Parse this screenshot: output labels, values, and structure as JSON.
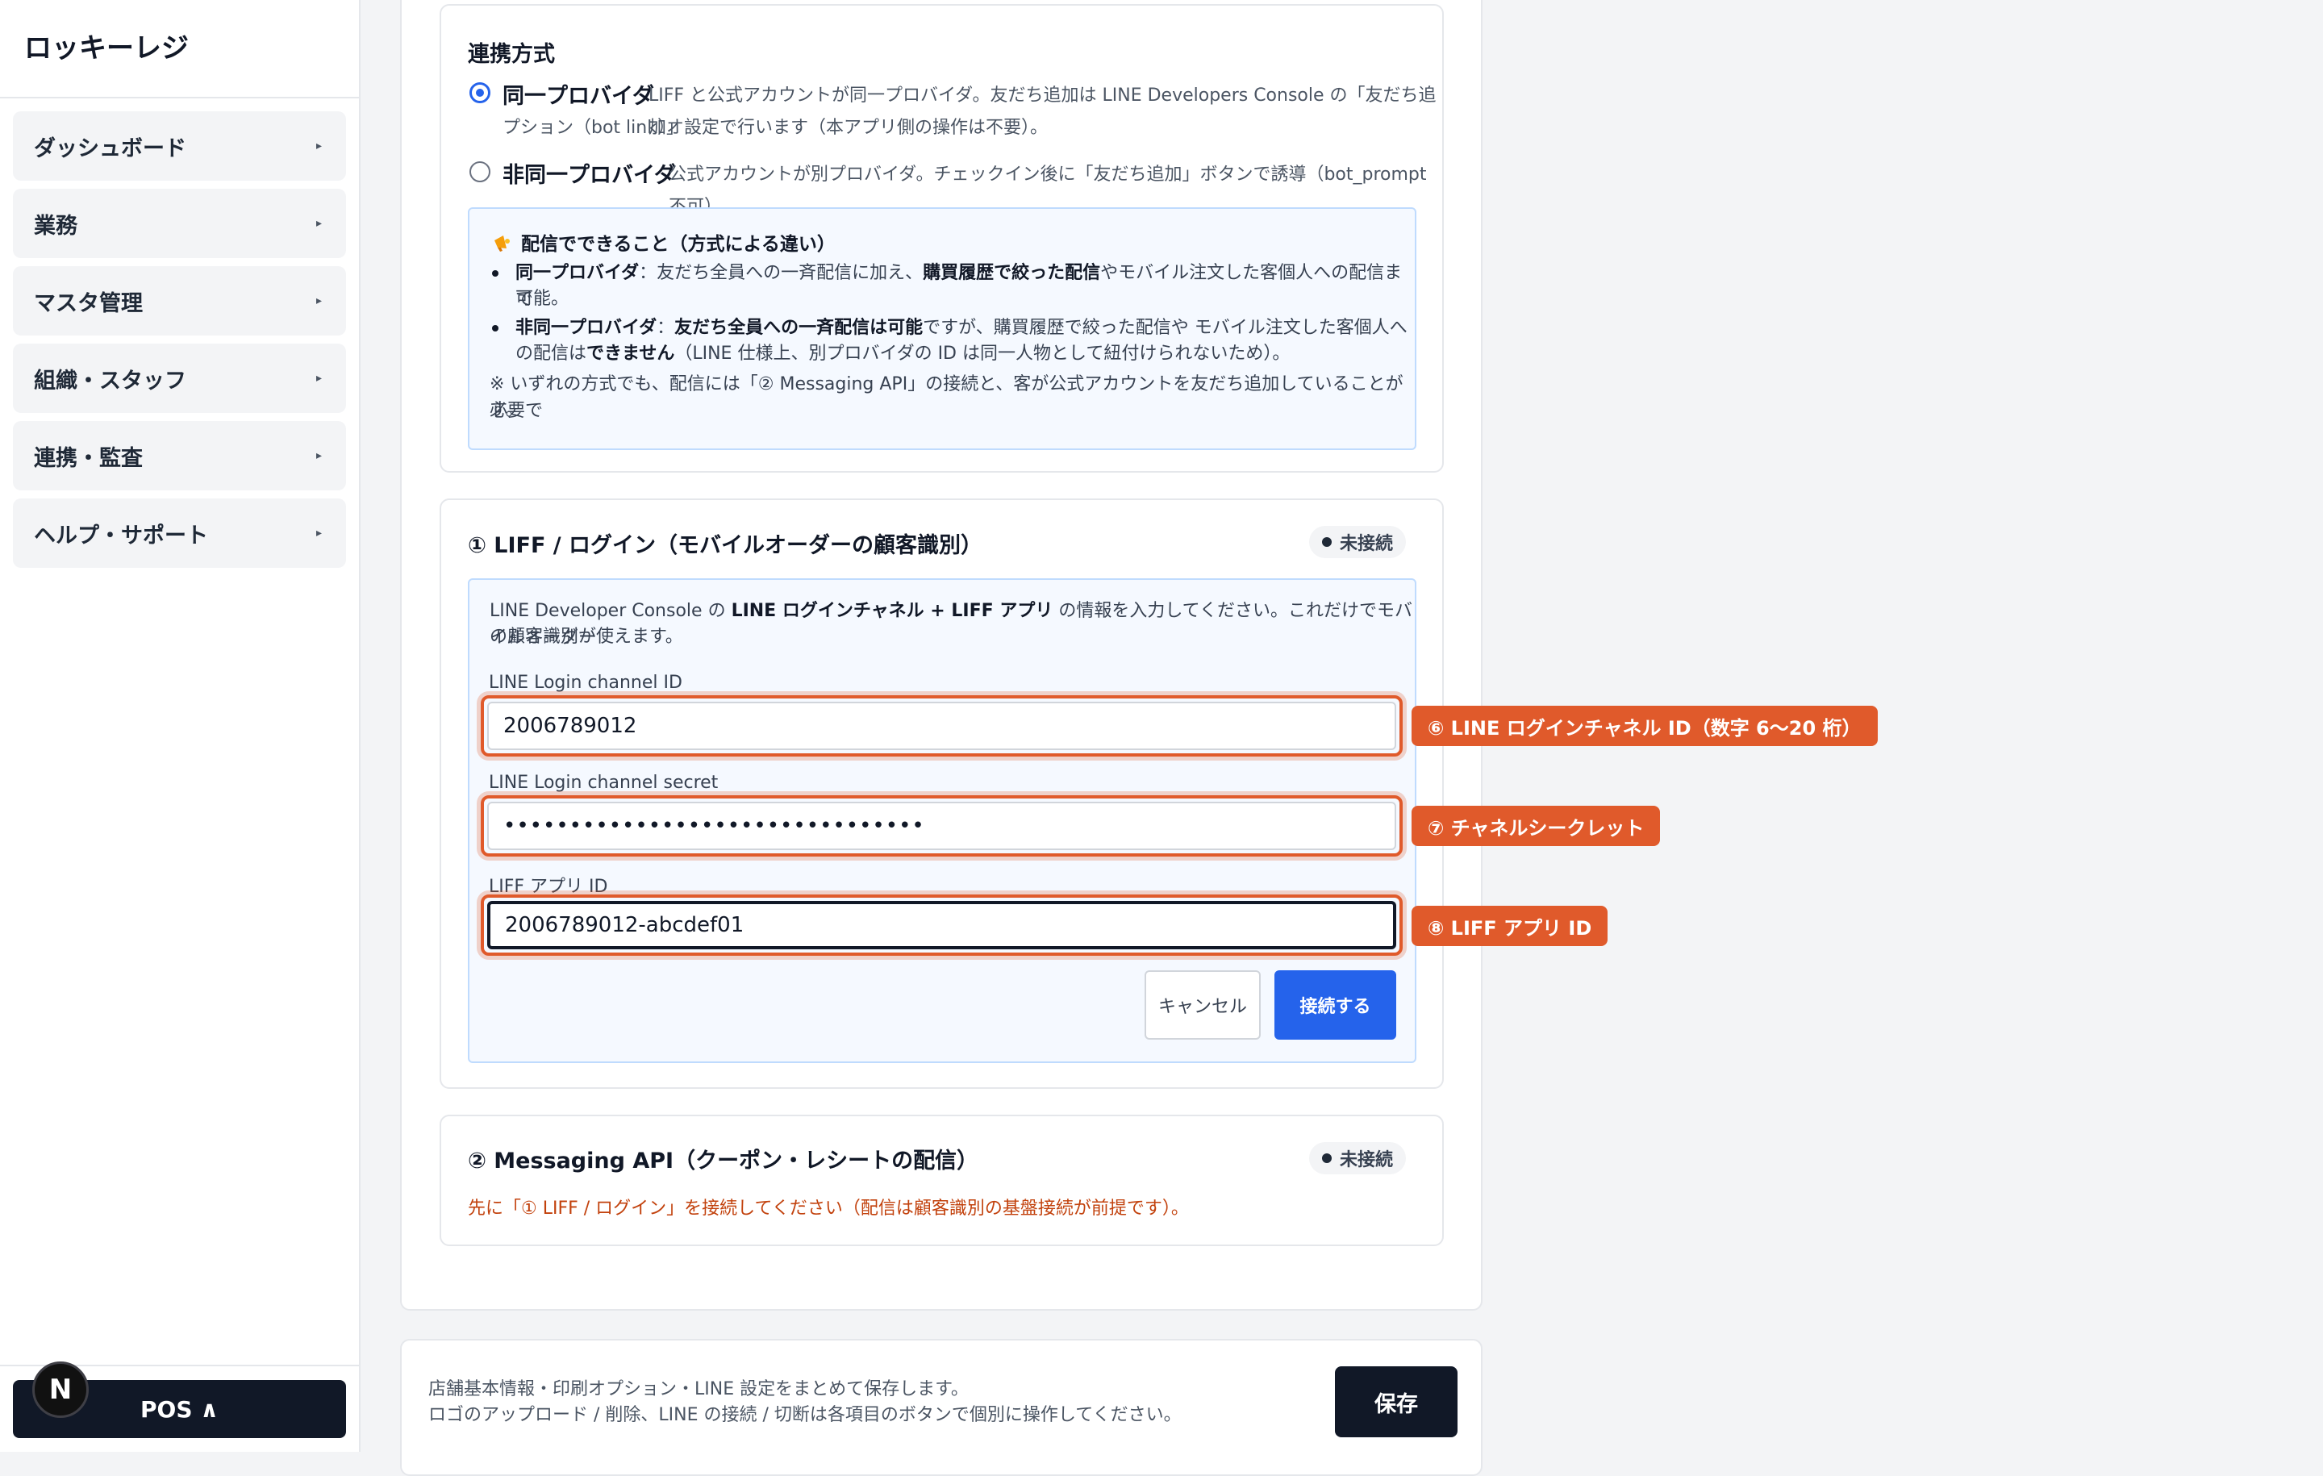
{
  "sidebar": {
    "brand": "ロッキーレジ",
    "items": [
      {
        "label": "ダッシュボード"
      },
      {
        "label": "業務"
      },
      {
        "label": "マスタ管理"
      },
      {
        "label": "組織・スタッフ"
      },
      {
        "label": "連携・監査"
      },
      {
        "label": "ヘルプ・サポート"
      }
    ],
    "arrow": "▸",
    "pos_button": "POS ∧",
    "n_badge": "N"
  },
  "connection": {
    "title": "連携方式",
    "options": [
      {
        "label": "同一プロバイダ",
        "desc_line1": "LIFF と公式アカウントが同一プロバイダ。友だち追加は LINE Developers Console の「友だち追加オ",
        "desc_line2": "プション（bot link）」設定で行います（本アプリ側の操作は不要）。",
        "checked": true
      },
      {
        "label": "非同一プロバイダ",
        "desc_line1": "公式アカウントが別プロバイダ。チェックイン後に「友だち追加」ボタンで誘導（bot_prompt 不可）",
        "checked": false
      }
    ],
    "info": {
      "icon": "megaphone-icon",
      "title": "配信でできること（方式による違い）",
      "b1_l1_a": "同一プロバイダ",
      "b1_l1_b": "：友だち全員への一斉配信に加え、",
      "b1_l1_c": "購買履歴で絞った配信",
      "b1_l1_d": "やモバイル注文した客個人への配信まで",
      "b1_l2": "可能。",
      "b2_l1_a": "非同一プロバイダ",
      "b2_l1_b": "：",
      "b2_l1_c": "友だち全員への一斉配信は可能",
      "b2_l1_d": "ですが、購買履歴で絞った配信や モバイル注文した客個人へ",
      "b2_l2_a": "の配信は",
      "b2_l2_b": "できません",
      "b2_l2_c": "（LINE 仕様上、別プロバイダの ID は同一人物として紐付けられないため）。",
      "note_l1": "※ いずれの方式でも、配信には「② Messaging API」の接続と、客が公式アカウントを友だち追加していることが必要で",
      "note_l2": "す。"
    }
  },
  "liff": {
    "title": "① LIFF / ログイン（モバイルオーダーの顧客識別）",
    "status": "未接続",
    "intro_l1_a": "LINE Developer Console の ",
    "intro_l1_b": "LINE ログインチャネル + LIFF アプリ",
    "intro_l1_c": " の情報を入力してください。これだけでモバイルオーダー",
    "intro_l2": "の顧客識別が使えます。",
    "fields": [
      {
        "label": "LINE Login channel ID",
        "value": "2006789012",
        "callout": "⑥ LINE ログインチャネル ID（数字 6〜20 桁）"
      },
      {
        "label": "LINE Login channel secret",
        "value": "••••••••••••••••••••••••••••••••",
        "callout": "⑦ チャネルシークレット"
      },
      {
        "label": "LIFF アプリ ID",
        "value": "2006789012-abcdef01",
        "callout": "⑧ LIFF アプリ ID"
      }
    ],
    "cancel": "キャンセル",
    "connect": "接続する"
  },
  "messaging": {
    "title": "② Messaging API（クーポン・レシートの配信）",
    "status": "未接続",
    "warning": "先に「① LIFF / ログイン」を接続してください（配信は顧客識別の基盤接続が前提です）。"
  },
  "footer": {
    "line1": "店舗基本情報・印刷オプション・LINE 設定をまとめて保存します。",
    "line2": "ロゴのアップロード / 削除、LINE の接続 / 切断は各項目のボタンで個別に操作してください。",
    "save": "保存"
  },
  "colors": {
    "accent": "#2563eb",
    "callout": "#e05a2b",
    "warning": "#c2410c"
  }
}
